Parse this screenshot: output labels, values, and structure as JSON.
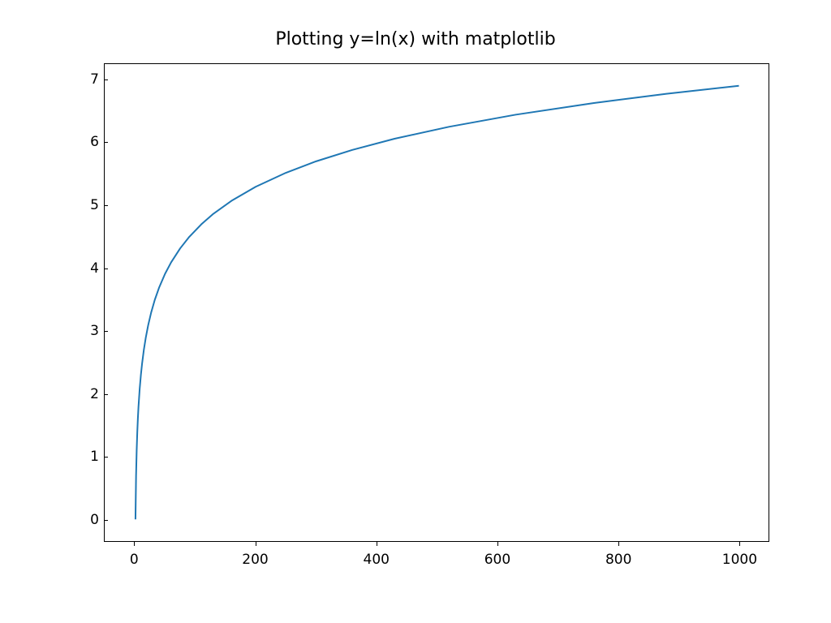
{
  "chart_data": {
    "type": "line",
    "title": "Plotting y=ln(x) with matplotlib",
    "xlabel": "",
    "ylabel": "",
    "xlim": [
      -49.95,
      1049.0
    ],
    "ylim": [
      -0.346,
      7.253
    ],
    "x_ticks": [
      0,
      200,
      400,
      600,
      800,
      1000
    ],
    "y_ticks": [
      0,
      1,
      2,
      3,
      4,
      5,
      6,
      7
    ],
    "series": [
      {
        "name": "ln(x)",
        "color": "#1f77b4",
        "x": [
          1,
          2,
          3,
          4,
          5,
          6,
          8,
          10,
          12,
          15,
          18,
          22,
          27,
          33,
          40,
          50,
          60,
          75,
          90,
          110,
          130,
          160,
          200,
          250,
          300,
          360,
          430,
          520,
          630,
          760,
          880,
          1000
        ],
        "y": [
          0.0,
          0.693,
          1.099,
          1.386,
          1.609,
          1.792,
          2.079,
          2.303,
          2.485,
          2.708,
          2.89,
          3.091,
          3.296,
          3.497,
          3.689,
          3.912,
          4.094,
          4.317,
          4.5,
          4.7,
          4.868,
          5.075,
          5.298,
          5.521,
          5.704,
          5.886,
          6.064,
          6.254,
          6.446,
          6.633,
          6.78,
          6.908
        ]
      }
    ]
  }
}
